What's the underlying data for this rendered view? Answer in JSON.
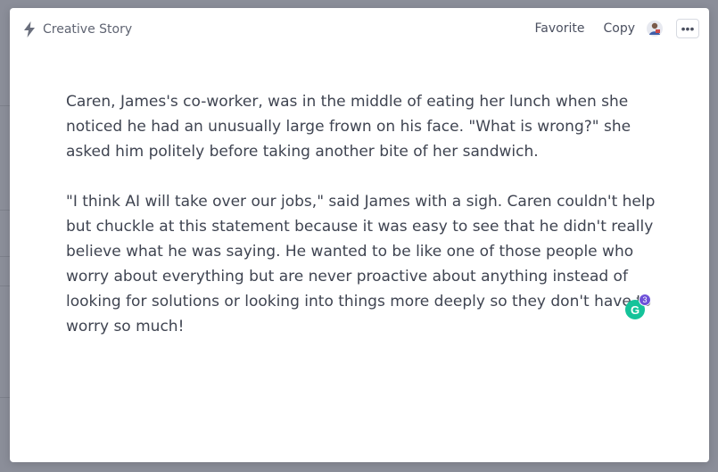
{
  "header": {
    "title": "Creative Story",
    "favorite_label": "Favorite",
    "copy_label": "Copy",
    "more_label": "•••"
  },
  "content": {
    "paragraphs": [
      "Caren, James's co-worker, was in the middle of eating her lunch when she noticed he had an unusually large frown on his face. \"What is wrong?\" she asked him politely before taking another bite of her sandwich.",
      "\"I think AI will take over our jobs,\" said James with a sigh. Caren couldn't help but chuckle at this statement because it was easy to see that he didn't really believe what he was saying. He wanted to be like one of those people who worry about everything but are never proactive about anything instead of looking for solutions or looking into things more deeply so they don't have to worry so much!"
    ]
  },
  "grammarly": {
    "letter": "G",
    "badge_count": "3"
  },
  "icons": {
    "title_icon": "bolt-icon",
    "avatar_icon": "avatar",
    "more_icon": "more-icon"
  },
  "colors": {
    "backdrop": "#8b8e99",
    "modal_bg": "#ffffff",
    "text": "#3f4451",
    "grammarly": "#15c39a",
    "badge": "#6f52d9"
  }
}
